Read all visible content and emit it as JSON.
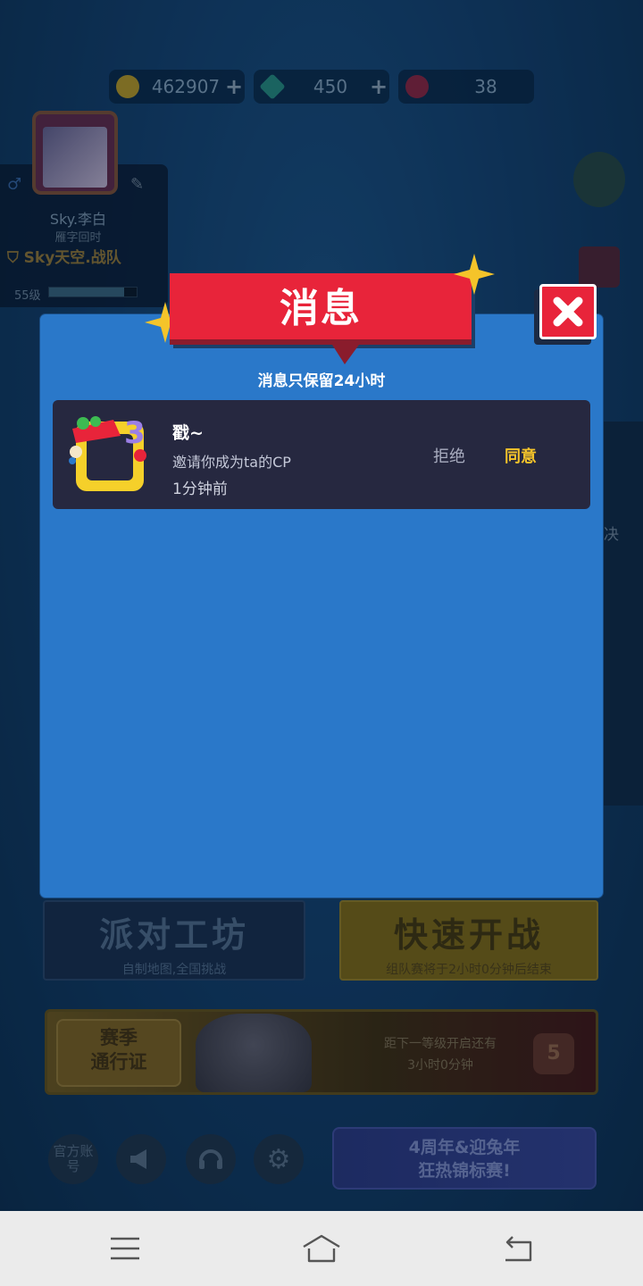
{
  "resources": {
    "coins": "462907",
    "gems": "450",
    "tickets": "38",
    "plus": "+"
  },
  "profile": {
    "name": "Sky.李白",
    "subtitle": "雁字回时",
    "team": "Sky天空.战队",
    "level": "55级",
    "xp_progress": 0.86
  },
  "lobby": {
    "workshop_title": "派对工坊",
    "workshop_sub": "自制地图,全国挑战",
    "quick_title": "快速开战",
    "quick_sub": "组队赛将于2小时0分钟后结束",
    "pass_label_1": "赛季",
    "pass_label_2": "通行证",
    "pass_next_1": "距下一等级开启还有",
    "pass_next_2": "3小时0分钟",
    "pass_level": "5",
    "official_account": "官方账号",
    "event_line_1": "4周年&迎兔年",
    "event_line_2": "狂热锦标赛!",
    "side_peek": "决"
  },
  "dialog": {
    "title": "消息",
    "hint": "消息只保留24小时",
    "message": {
      "name": "戳~",
      "text": "邀请你成为ta的CP",
      "time": "1分钟前",
      "reject": "拒绝",
      "accept": "同意"
    }
  },
  "colors": {
    "modal_bg": "#2a78c9",
    "ribbon": "#e8243a",
    "accept": "#f5c42a",
    "card_bg": "#262840"
  }
}
